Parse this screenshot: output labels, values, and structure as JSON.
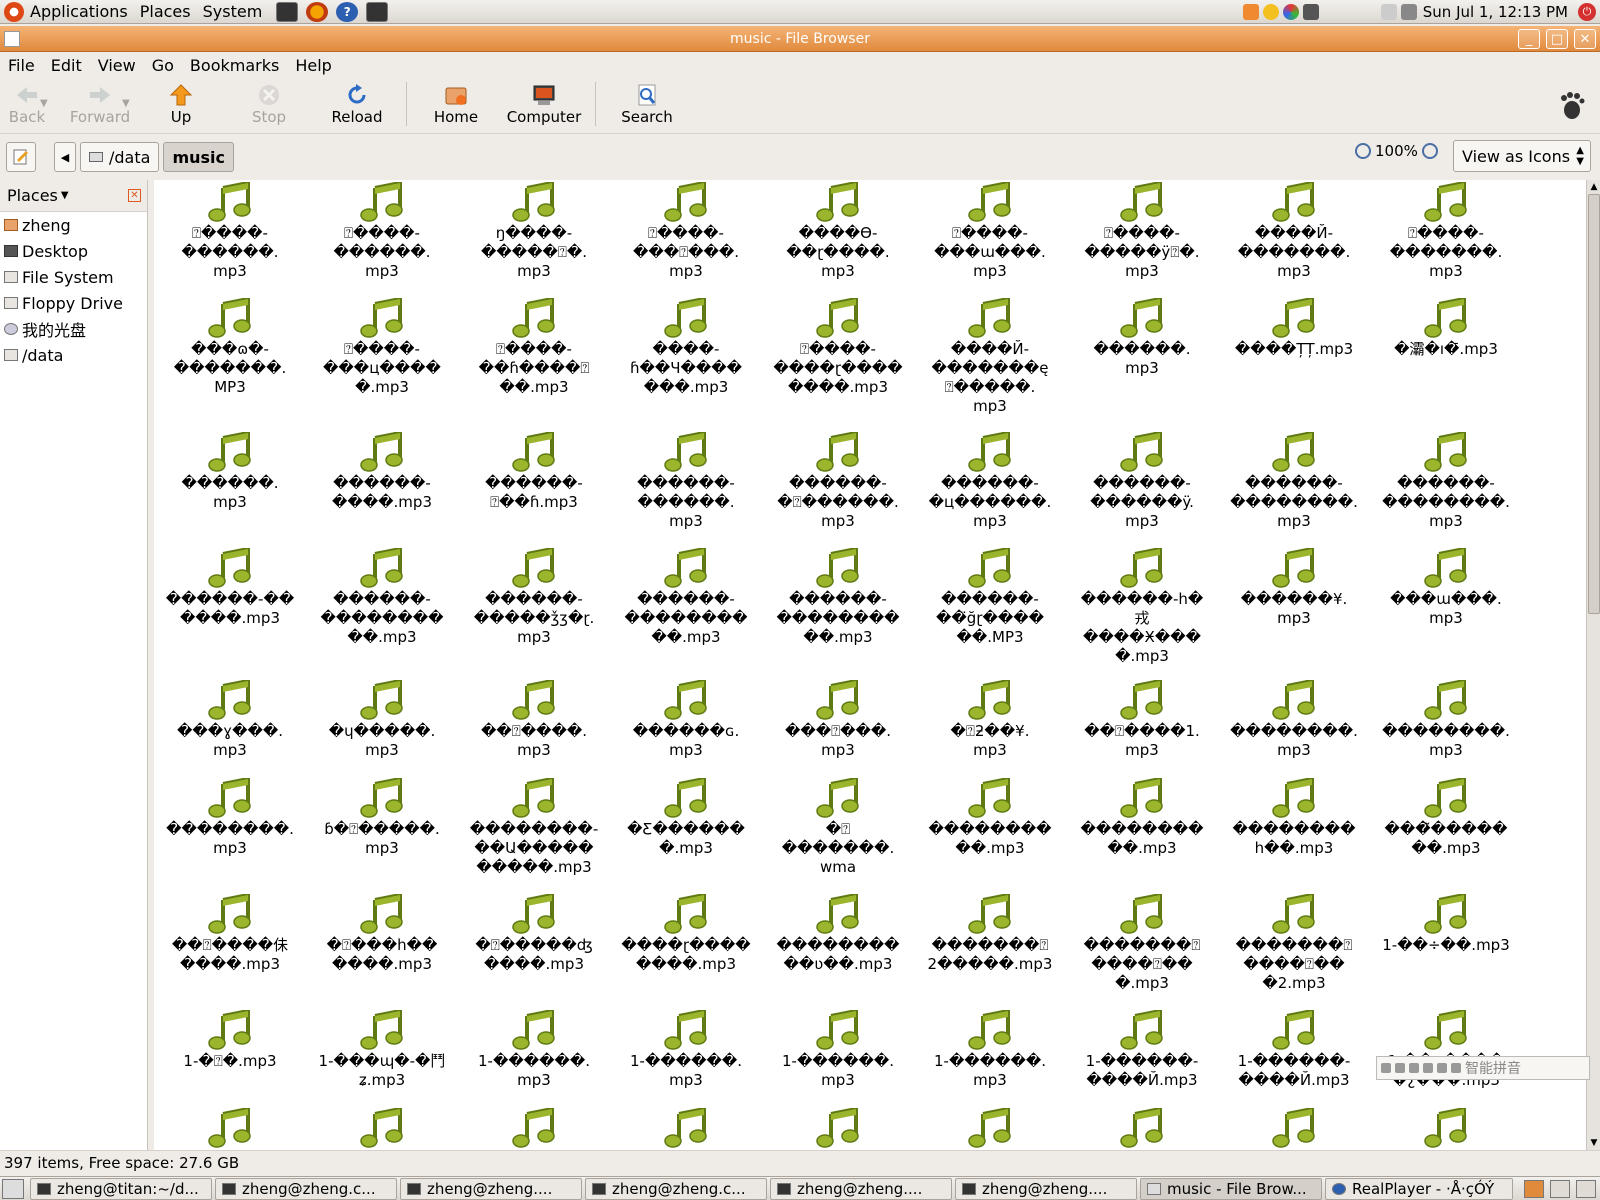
{
  "panel": {
    "menus": [
      "Applications",
      "Places",
      "System"
    ],
    "clock": "Sun Jul  1, 12:13 PM"
  },
  "window": {
    "title": "music - File Browser",
    "buttons": [
      "_",
      "□",
      "✕"
    ]
  },
  "menubar": [
    "File",
    "Edit",
    "View",
    "Go",
    "Bookmarks",
    "Help"
  ],
  "toolbar": {
    "back": "Back",
    "forward": "Forward",
    "up": "Up",
    "stop": "Stop",
    "reload": "Reload",
    "home": "Home",
    "computer": "Computer",
    "search": "Search"
  },
  "location": {
    "crumbs": [
      "/data",
      "music"
    ],
    "zoom": "100%",
    "view_mode": "View as Icons"
  },
  "sidebar": {
    "header": "Places",
    "items": [
      "zheng",
      "Desktop",
      "File System",
      "Floppy Drive",
      "我的光盘",
      "/data"
    ]
  },
  "files": [
    [
      "⍰����-\n������.\nmp3",
      "⍰����-\n������.\nmp3",
      "ŋ����-\n�����⍰�.\nmp3",
      "⍰����-\n���⍰���.\nmp3",
      "����Ө-\n��ɽ����.\nmp3",
      "⍰����-\n���ɯ���.\nmp3",
      "⍰����-\n�����ÿ⍰�.\nmp3",
      "����Й-\n�������.\nmp3",
      "⍰����-\n�������.\nmp3"
    ],
    [
      "���ɷ�-\n�������.\nMP3",
      "⍰����-\n���ц����\n�.mp3",
      "⍰����-\n��ɦ����⍰\n��.mp3",
      "����-\nɦ��Ч����\n���.mp3",
      "⍰����-\n����ɽ����\n����.mp3",
      "����Й-\n�������ę\n⍰�����.\nmp3",
      "������.\nmp3",
      "����ȚȚ.mp3",
      "�灞�ı�̄.mp3"
    ],
    [
      "������.\nmp3",
      "������-\n����.mp3",
      "������-\n⍰��ɦ.mp3",
      "������-\n������.\nmp3",
      "������-\n�⍰������.\nmp3",
      "������-\n�ц������.\nmp3",
      "������-\n������ÿ.\nmp3",
      "������-\n��������.\nmp3",
      "������-\n��������.\nmp3"
    ],
    [
      "������-��\n����.mp3",
      "������-\n��������\n��.mp3",
      "������-\n�����ǯʒ�ɽ.\nmp3",
      "������-\n��������\n��.mp3",
      "������-\n��������\n��.mp3",
      "������-\n��̈ğɽ����\n��.MP3",
      "������-h�\n戎\n����Ӿ���\n�.mp3",
      "������¥.\nmp3",
      "���ɯ���.\nmp3"
    ],
    [
      "���ɣ���.\nmp3",
      "�ɥ�����.\nmp3",
      "��⍰����.\nmp3",
      "������ɢ.\nmp3",
      "���⍰���.\nmp3",
      "�⍰ƻ��¥.\nmp3",
      "��⍰����1.\nmp3",
      "��������.\nmp3",
      "��������.\nmp3"
    ],
    [
      "��������.\nmp3",
      "ɓ�⍰�����.\nmp3",
      "��������-\n��Ա�����\n�����.mp3",
      "�Ƹ������\n�.mp3",
      "�⍰\n�������.\nwma",
      "��������\n��.mp3",
      "��������\n��.mp3",
      "��������\nh��.mp3",
      "���̃�����\n��.mp3"
    ],
    [
      "��⍰����佅\n����.mp3",
      "�⍰���h��\n����.mp3",
      "�⍰�����ʤ\n����.mp3",
      "����ɽ����\n����.mp3",
      "��������\n��ʋ��.mp3",
      "�������⍰\n2�����.mp3",
      "�������⍰\n����⍰��\n�.mp3",
      "�������⍰\n����⍰��\n�2.mp3",
      "1-��÷��.mp3"
    ],
    [
      "1-�⍰�.mp3",
      "1-���ɰ�-�鬥\nʑ.mp3",
      "1-������.\nmp3",
      "1-������.\nmp3",
      "1-������.\nmp3",
      "1-������.\nmp3",
      "1-������-\n����Й.mp3",
      "1-������-\n����Й.mp3",
      "1-��ɥ����\n�¿���.mp3"
    ]
  ],
  "status": "397 items, Free space: 27.6 GB",
  "ime": "智能拼音",
  "taskbar": [
    "zheng@titan:~/d...",
    "zheng@zheng.c...",
    "zheng@zheng....",
    "zheng@zheng.c...",
    "zheng@zheng....",
    "zheng@zheng....",
    "music - File Brow...",
    "RealPlayer - ·Å·çÓÝ"
  ],
  "colors": {
    "title_bar": "#e08a3c",
    "note_icon": "#9bb52c"
  }
}
